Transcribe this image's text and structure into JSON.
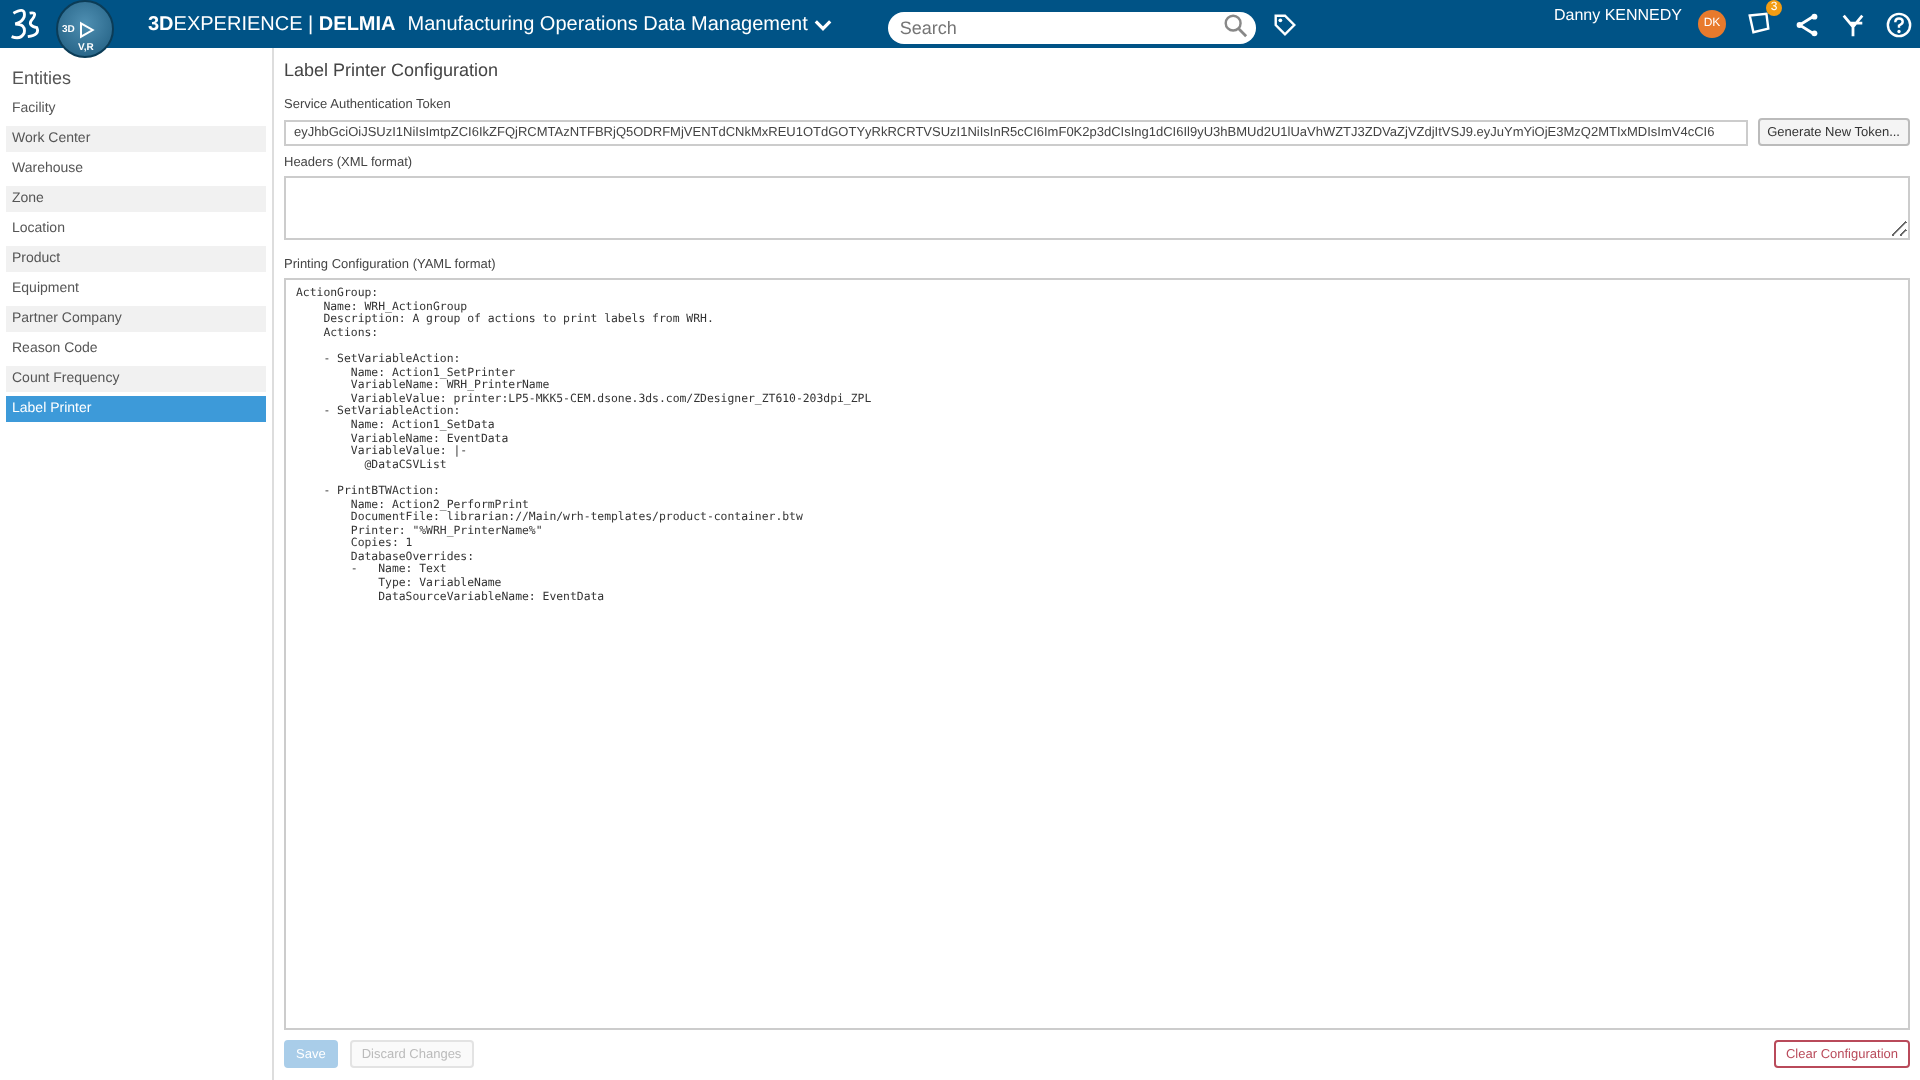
{
  "topbar": {
    "brand_bold": "3D",
    "brand_rest": "EXPERIENCE | ",
    "brand_app": "DELMIA",
    "app_title": "Manufacturing Operations Data Management",
    "search": {
      "placeholder": "Search"
    },
    "user": "Danny KENNEDY",
    "avatar": "DK",
    "notifications": "3"
  },
  "compass": {
    "labels": [
      "3D",
      "V,R"
    ]
  },
  "sidebar": {
    "title": "Entities",
    "items": [
      {
        "label": "Facility",
        "selected": false
      },
      {
        "label": "Work Center",
        "selected": false
      },
      {
        "label": "Warehouse",
        "selected": false
      },
      {
        "label": "Zone",
        "selected": false
      },
      {
        "label": "Location",
        "selected": false
      },
      {
        "label": "Product",
        "selected": false
      },
      {
        "label": "Equipment",
        "selected": false
      },
      {
        "label": "Partner Company",
        "selected": false
      },
      {
        "label": "Reason Code",
        "selected": false
      },
      {
        "label": "Count Frequency",
        "selected": false
      },
      {
        "label": "Label Printer",
        "selected": true
      }
    ]
  },
  "main": {
    "title": "Label Printer Configuration",
    "token": {
      "label": "Service Authentication Token",
      "value": "eyJhbGciOiJSUzI1NiIsImtpZCI6IkZFQjRCMTAzNTFBRjQ5ODRFMjVENTdCNkMxREU1OTdGOTYyRkRCRTVSUzI1NiIsInR5cCI6ImF0K2p3dCIsIng1dCI6Il9yU3hBMUd2U1lUaVhWZTJ3ZDVaZjVZdjItVSJ9.eyJuYmYiOjE3MzQ2MTIxMDIsImV4cCI6",
      "button": "Generate New Token..."
    },
    "headers": {
      "label": "Headers (XML format)"
    },
    "yaml": {
      "label": "Printing Configuration (YAML format)",
      "value": "ActionGroup:\n    Name: WRH_ActionGroup\n    Description: A group of actions to print labels from WRH.\n    Actions:\n\n    - SetVariableAction:\n        Name: Action1_SetPrinter\n        VariableName: WRH_PrinterName\n        VariableValue: printer:LP5-MKK5-CEM.dsone.3ds.com/ZDesigner_ZT610-203dpi_ZPL\n    - SetVariableAction:\n        Name: Action1_SetData\n        VariableName: EventData\n        VariableValue: |-\n          @DataCSVList\n\n    - PrintBTWAction:\n        Name: Action2_PerformPrint\n        DocumentFile: librarian://Main/wrh-templates/product-container.btw\n        Printer: \"%WRH_PrinterName%\"\n        Copies: 1\n        DatabaseOverrides:\n        -   Name: Text\n            Type: VariableName\n            DataSourceVariableName: EventData"
    },
    "buttons": [
      {
        "label": "Save",
        "kind": "primary",
        "disabled": true
      },
      {
        "label": "Discard Changes",
        "kind": "secondary",
        "disabled": true
      },
      {
        "label": "Clear Configuration",
        "kind": "danger",
        "disabled": false
      }
    ]
  }
}
